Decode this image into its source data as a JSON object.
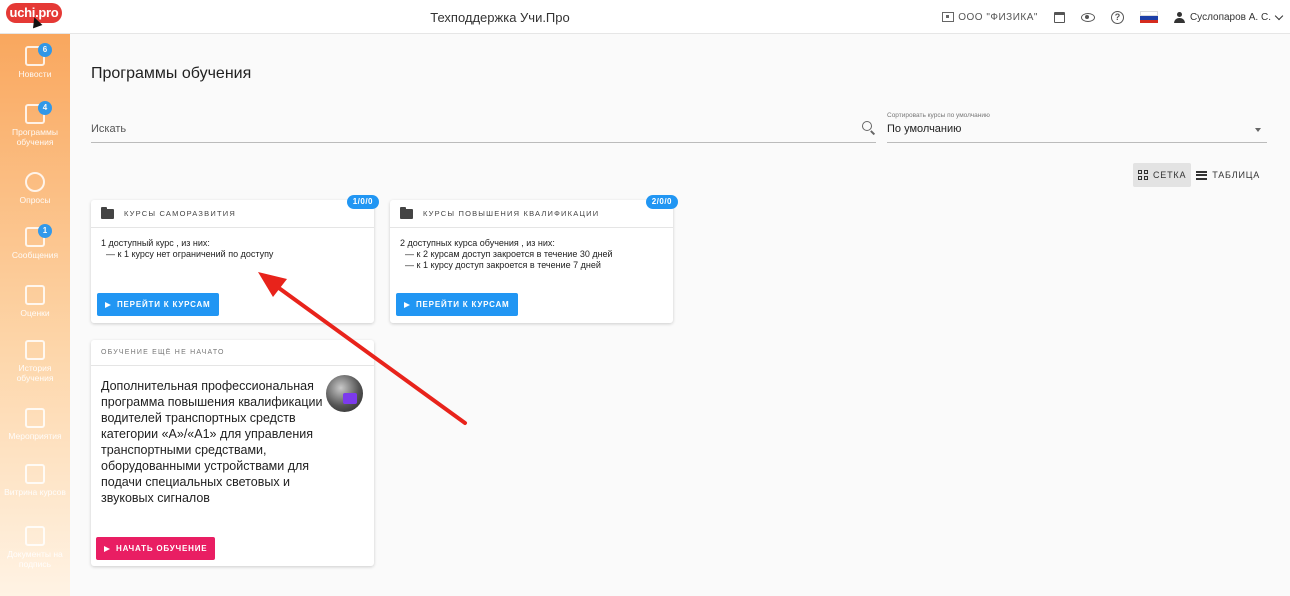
{
  "header": {
    "logo_text": "uchi.pro",
    "title": "Техподдержка Учи.Про",
    "organization": "ООО \"ФИЗИКА\"",
    "user_name": "Суслопаров А. С.",
    "icons": [
      "building-icon",
      "calendar-icon",
      "eye-icon",
      "help-icon",
      "flag-ru-icon",
      "user-icon",
      "chevron-down-icon"
    ],
    "flag_colors": [
      "#ffffff",
      "#1c3fa8",
      "#d52b1e"
    ]
  },
  "sidebar": {
    "items": [
      {
        "label": "Новости",
        "badge": "6",
        "icon": "news-icon"
      },
      {
        "label": "Программы обучения",
        "badge": "4",
        "icon": "programs-icon"
      },
      {
        "label": "Опросы",
        "badge": "",
        "icon": "survey-icon"
      },
      {
        "label": "Сообщения",
        "badge": "1",
        "icon": "messages-icon"
      },
      {
        "label": "Оценки",
        "badge": "",
        "icon": "grades-icon"
      },
      {
        "label": "История обучения",
        "badge": "",
        "icon": "history-icon"
      },
      {
        "label": "Мероприятия",
        "badge": "",
        "icon": "events-icon"
      },
      {
        "label": "Витрина курсов",
        "badge": "",
        "icon": "showcase-icon"
      },
      {
        "label": "Документы на подпись",
        "badge": "",
        "icon": "documents-icon"
      }
    ]
  },
  "main": {
    "title": "Программы обучения",
    "search": {
      "placeholder": "Искать"
    },
    "sort": {
      "label": "Сортировать курсы по умолчанию",
      "value": "По умолчанию"
    },
    "views": {
      "grid": "СЕТКА",
      "table": "ТАБЛИЦА"
    },
    "cards": [
      {
        "title": "КУРСЫ САМОРАЗВИТИЯ",
        "badge": "1/0/0",
        "summary": "1 доступный курс , из них:",
        "lines": [
          "— к 1 курсу нет ограничений по доступу"
        ],
        "button": "ПЕРЕЙТИ К КУРСАМ"
      },
      {
        "title": "КУРСЫ ПОВЫШЕНИЯ КВАЛИФИКАЦИИ",
        "badge": "2/0/0",
        "summary": "2 доступных курса обучения , из них:",
        "lines": [
          "— к 2 курсам доступ закроется в течение 30 дней",
          "— к 1 курсу доступ закроется в течение 7 дней"
        ],
        "button": "ПЕРЕЙТИ К КУРСАМ"
      }
    ],
    "program": {
      "status": "ОБУЧЕНИЕ ЕЩЁ НЕ НАЧАТО",
      "title": "Дополнительная профессиональная программа повышения квалификации водителей транспортных средств категории «А»/«А1» для управления транспортными средствами, оборудованными устройствами для подачи специальных световых и звуковых сигналов",
      "button": "НАЧАТЬ ОБУЧЕНИЕ"
    }
  },
  "annotation": {
    "color": "#e8231b",
    "shape": "arrow"
  }
}
